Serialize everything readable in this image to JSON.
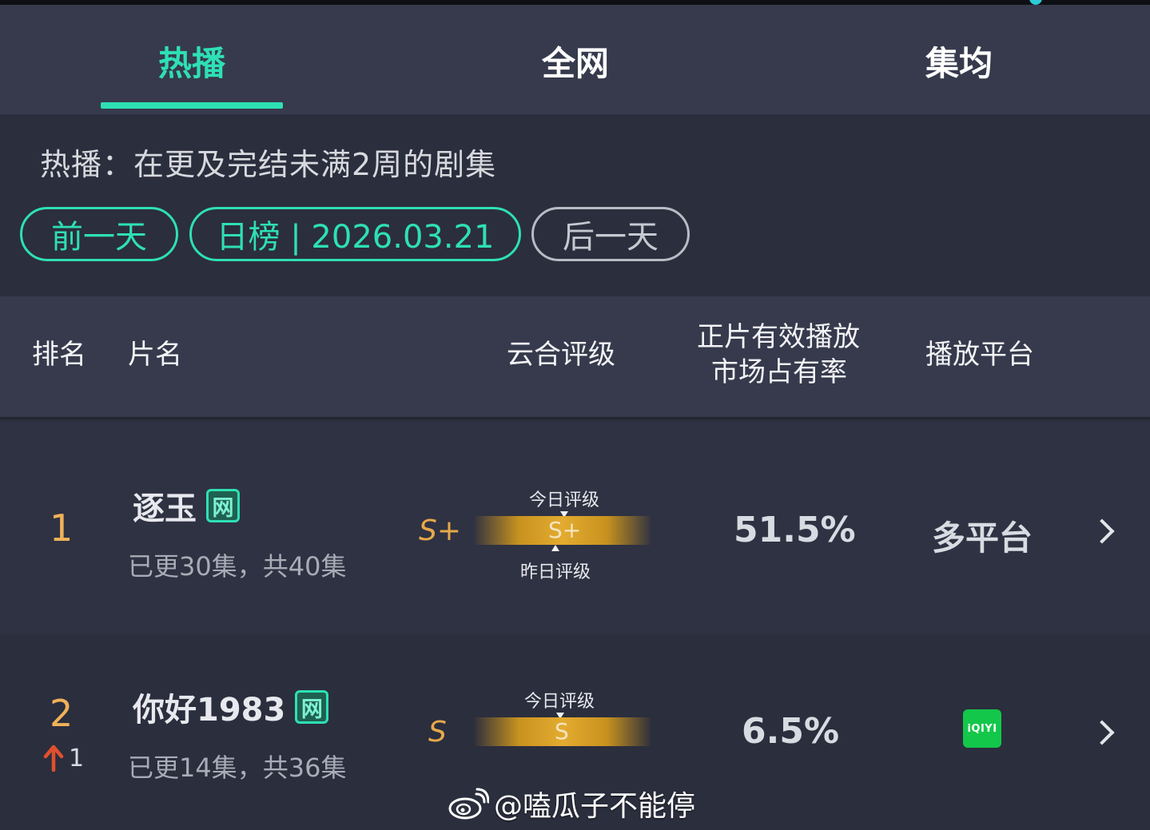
{
  "tabs": [
    {
      "label": "热播",
      "active": true
    },
    {
      "label": "全网",
      "active": false
    },
    {
      "label": "集均",
      "active": false
    }
  ],
  "filter": {
    "description": "热播：在更及完结未满2周的剧集",
    "prev_day": "前一天",
    "date_pill": "日榜 | 2026.03.21",
    "next_day": "后一天"
  },
  "table_header": {
    "rank": "排名",
    "title": "片名",
    "rating": "云合评级",
    "share_line1": "正片有效播放",
    "share_line2": "市场占有率",
    "platform": "播放平台"
  },
  "rows": [
    {
      "rank": "1",
      "title": "逐玉",
      "badge": "网",
      "episodes": "已更30集，共40集",
      "grade": "S+",
      "today_label": "今日评级",
      "bar_grade": "S+",
      "yesterday_label": "昨日评级",
      "share": "51.5%",
      "platform": "多平台"
    },
    {
      "rank": "2",
      "rank_change": "1",
      "title": "你好1983",
      "badge": "网",
      "episodes": "已更14集，共36集",
      "grade": "S",
      "today_label": "今日评级",
      "bar_grade": "S",
      "share": "6.5%",
      "platform_logo": "iQIYI"
    }
  ],
  "watermark": "@嗑瓜子不能停",
  "colors": {
    "accent": "#2ee0b4",
    "grade": "#e6a94a",
    "rank": "#f0b259",
    "bg": "#2b2e3d",
    "header_bg": "#363a4c",
    "iqiyi": "#13c74a",
    "rank_up": "#e0502d"
  }
}
